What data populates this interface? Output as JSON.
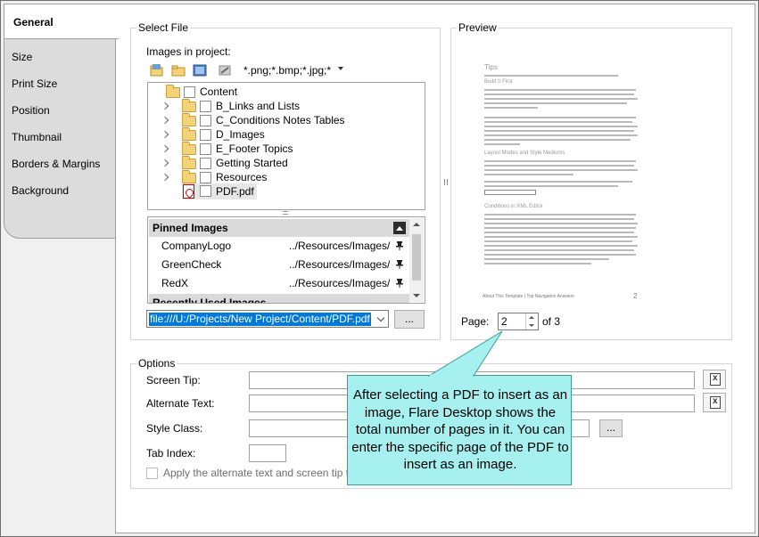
{
  "tabs": [
    {
      "label": "General",
      "active": true
    },
    {
      "label": "Size"
    },
    {
      "label": "Print Size"
    },
    {
      "label": "Position"
    },
    {
      "label": "Thumbnail"
    },
    {
      "label": "Borders & Margins"
    },
    {
      "label": "Background"
    }
  ],
  "select_file": {
    "title": "Select File",
    "images_label": "Images in project:",
    "filter": "*.png;*.bmp;*.jpg;*",
    "toolbar_icons": [
      "folder-open-icon",
      "new-folder-icon",
      "view-icon",
      "refresh-icon"
    ],
    "tree": [
      {
        "label": "Content",
        "type": "root"
      },
      {
        "label": "B_Links and Lists",
        "type": "folder"
      },
      {
        "label": "C_Conditions Notes Tables",
        "type": "folder"
      },
      {
        "label": "D_Images",
        "type": "folder"
      },
      {
        "label": "E_Footer Topics",
        "type": "folder"
      },
      {
        "label": "Getting Started",
        "type": "folder"
      },
      {
        "label": "Resources",
        "type": "folder"
      },
      {
        "label": "PDF.pdf",
        "type": "pdf"
      }
    ],
    "pinned_header": "Pinned Images",
    "pinned": [
      {
        "name": "CompanyLogo",
        "path": "../Resources/Images/"
      },
      {
        "name": "GreenCheck",
        "path": "../Resources/Images/"
      },
      {
        "name": "RedX",
        "path": "../Resources/Images/"
      }
    ],
    "recent_header": "Recently Used Images",
    "path": "file:///U:/Projects/New Project/Content/PDF.pdf",
    "browse_label": "..."
  },
  "preview": {
    "title": "Preview",
    "doc_heading1": "Tips",
    "doc_heading2": "Build It First",
    "doc_heading3": "Layout Modes and Style Mediums",
    "doc_heading4": "Conditions in XML Editor",
    "doc_footer": "About This Template | Top Navigation Answers",
    "doc_page": "2",
    "page_label": "Page:",
    "page_value": "2",
    "page_total": "of 3"
  },
  "options": {
    "title": "Options",
    "screen_tip_label": "Screen Tip:",
    "alt_text_label": "Alternate Text:",
    "style_class_label": "Style Class:",
    "tab_index_label": "Tab Index:",
    "apply_label": "Apply the alternate text and screen tip to a",
    "style_browse_label": "..."
  },
  "callout": {
    "text": "After selecting a PDF to insert as an image, Flare Desktop shows the total number of pages in it. You can enter the specific page of the PDF to insert as an image."
  },
  "colors": {
    "callout_bg": "#a6f0f0",
    "selection": "#0078d7",
    "tab_bg": "#dcdcdc"
  }
}
